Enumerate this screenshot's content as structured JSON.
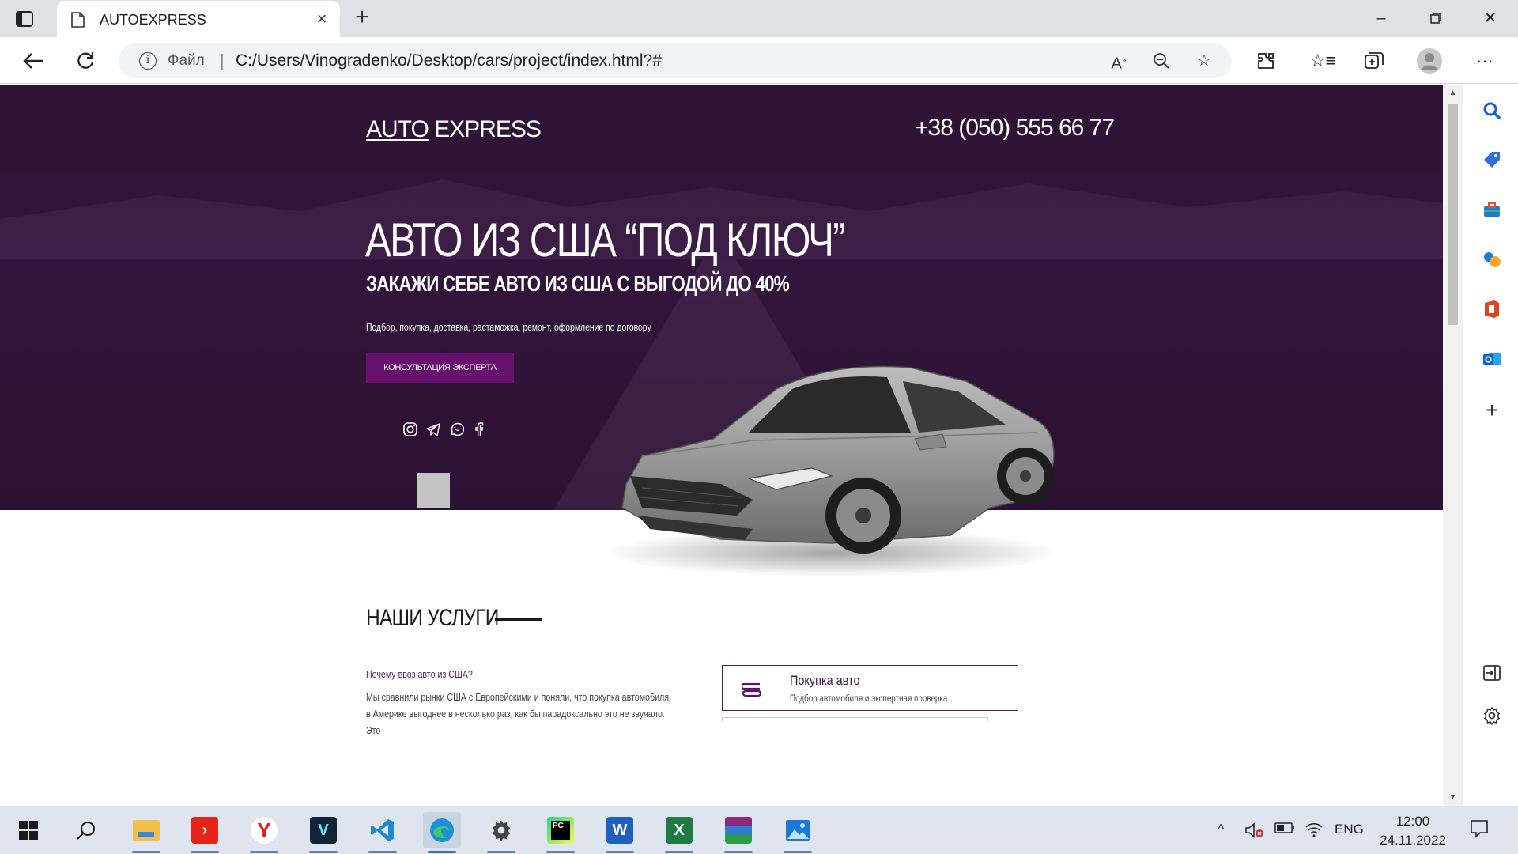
{
  "browser": {
    "tab_title": "AUTOEXPRESS",
    "scheme_label": "Файл",
    "url": "C:/Users/Vinogradenko/Desktop/cars/project/index.html?#"
  },
  "page": {
    "logo_part1": "AUTO",
    "logo_part2": " EXPRESS",
    "phone": "+38 (050) 555 66 77",
    "headline": "АВТО ИЗ США “ПОД КЛЮЧ”",
    "subheadline": "ЗАКАЖИ СЕБЕ АВТО ИЗ США С ВЫГОДОЙ ДО 40%",
    "lead": "Подбор, покупка, доставка, растаможка, ремонт, оформление по договору",
    "cta_label": "КОНСУЛЬТАЦИЯ ЭКСПЕРТА",
    "socials": [
      "instagram-icon",
      "telegram-icon",
      "whatsapp-icon",
      "facebook-icon"
    ],
    "services": {
      "title": "НАШИ УСЛУГИ",
      "why_title": "Почему ввоз авто из США?",
      "why_text": "Мы сравнили рынки США с Европейскими и поняли, что покупка автомобиля в Америке выгоднее в несколько раз, как бы парадоксально это не звучало. Это",
      "card_title": "Покупка авто",
      "card_subtitle": "Подбор автомобиля и экспертная проверка"
    },
    "colors": {
      "hero_bg": "#2d1335",
      "accent": "#67106e"
    }
  },
  "taskbar": {
    "language": "ENG",
    "time": "12:00",
    "date": "24.11.2022",
    "apps": [
      "windows-start",
      "search",
      "file-explorer",
      "anydesk",
      "yandex-browser",
      "v-app",
      "vscode",
      "edge",
      "settings",
      "pycharm",
      "word",
      "excel",
      "winrar",
      "photos"
    ]
  }
}
